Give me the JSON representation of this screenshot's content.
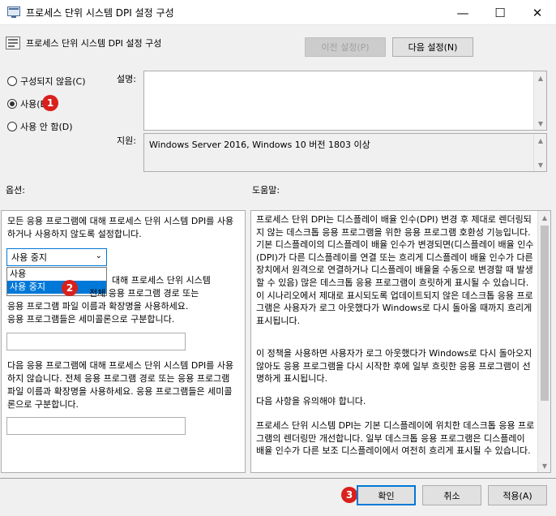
{
  "window": {
    "title": "프로세스 단위 시스템 DPI 설정 구성",
    "minimize_glyph": "—",
    "maximize_glyph": "☐",
    "close_glyph": "✕"
  },
  "header": {
    "setting_name": "프로세스 단위 시스템 DPI 설정 구성",
    "prev_button": "이전 설정(P)",
    "next_button": "다음 설정(N)"
  },
  "state": {
    "options": [
      {
        "label": "구성되지 않음(C)",
        "selected": false
      },
      {
        "label": "사용(E)",
        "selected": true
      },
      {
        "label": "사용 안 함(D)",
        "selected": false
      }
    ]
  },
  "comment": {
    "label": "설명:",
    "value": ""
  },
  "supported": {
    "label": "지원:",
    "value": "Windows Server 2016, Windows 10 버전 1803 이상"
  },
  "sections": {
    "options_label": "옵션:",
    "help_label": "도움말:"
  },
  "options_panel": {
    "desc1": "모든 응용 프로그램에 대해 프로세스 단위 시스템 DPI를 사용하거나 사용하지 않도록 설정합니다.",
    "dropdown_value": "사용 중지",
    "dropdown_items": [
      "사용",
      "사용 중지"
    ],
    "desc2_line1": "대해 프로세스 단위 시스템",
    "desc2_line2_visible": "전체 응용 프로그램 경로 또는",
    "desc2_line2_prefix": "DPI를 사용합니다.",
    "desc2_line3": "응용 프로그램 파일 이름과 확장명을 사용하세요.",
    "desc2_line4": "응용 프로그램들은 세미콜론으로 구분합니다.",
    "input1_value": "",
    "desc3": "다음 응용 프로그램에 대해 프로세스 단위 시스템 DPI를 사용하지 않습니다. 전체 응용 프로그램 경로 또는 응용 프로그램 파일 이름과 확장명을 사용하세요. 응용 프로그램들은 세미콜론으로 구분합니다.",
    "input2_value": ""
  },
  "help_panel": {
    "p1": "프로세스 단위 DPI는 디스플레이 배율 인수(DPI) 변경 후 제대로 렌더링되지 않는 데스크톱 응용 프로그램을 위한 응용 프로그램 호환성 기능입니다. 기본 디스플레이의 디스플레이 배율 인수가 변경되면(디스플레이 배율 인수(DPI)가 다른 디스플레이를 연결 또는 흐리게 디스플레이 배율 인수가 다른 장치에서 원격으로 연결하거나 디스플레이 배율을 수동으로 변경할 때 발생할 수 있음) 많은 데스크톱 응용 프로그램이 흐릿하게 표시될 수 있습니다. 이 시나리오에서 제대로 표시되도록 업데이트되지 않은 데스크톱 응용 프로그램은 사용자가 로그 아웃했다가 Windows로 다시 돌아올 때까지 흐리게 표시됩니다.",
    "p2": "이 정책을 사용하면 사용자가 로그 아웃했다가 Windows로 다시 돌아오지 않아도 응용 프로그램을 다시 시작한 후에 일부 흐릿한 응용 프로그램이 선명하게 표시됩니다.",
    "p3": "다음 사항을 유의해야 합니다.",
    "p4": "프로세스 단위 시스템 DPI는 기본 디스플레이에 위치한 데스크톱 응용 프로그램의 렌더링만 개선합니다. 일부 데스크톱 응용 프로그램은 디스플레이 배율 인수가 다른 보조 디스플레이에서 여전히 흐리게 표시될 수 있습니다."
  },
  "footer": {
    "ok": "확인",
    "cancel": "취소",
    "apply": "적용(A)"
  },
  "badges": {
    "b1": "1",
    "b2": "2",
    "b3": "3"
  },
  "colors": {
    "accent": "#0078d7",
    "badge": "#d9201d"
  }
}
